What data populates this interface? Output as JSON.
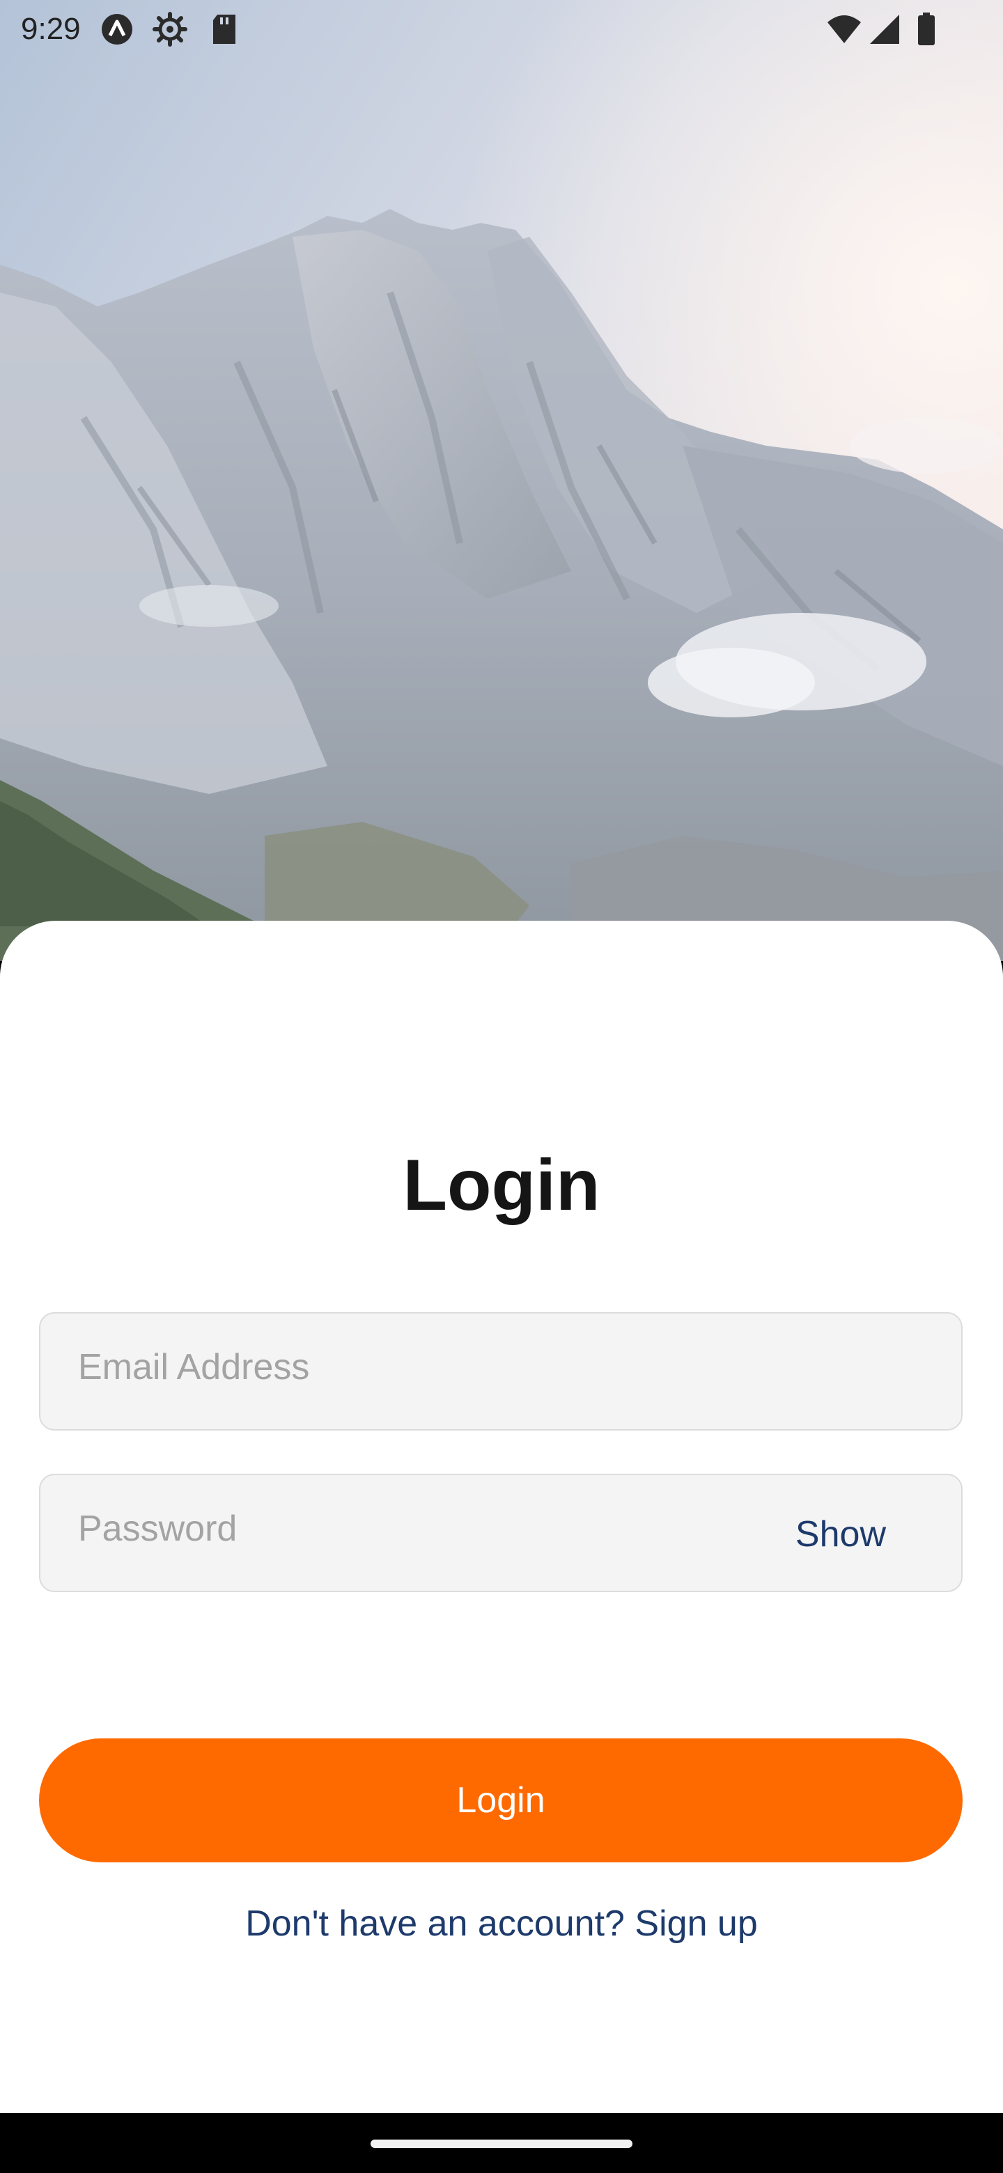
{
  "status_bar": {
    "time": "9:29",
    "left_icons": [
      "expo-icon",
      "settings-icon",
      "sd-card-icon"
    ],
    "right_icons": [
      "wifi-icon",
      "cell-signal-icon",
      "battery-icon"
    ]
  },
  "hero": {
    "image": "mountain-landscape"
  },
  "login": {
    "title": "Login",
    "email_placeholder": "Email Address",
    "email_value": "",
    "password_placeholder": "Password",
    "password_value": "",
    "show_label": "Show",
    "button_label": "Login",
    "signup_text": "Don't have an account? Sign up"
  },
  "colors": {
    "accent": "#ff6a00",
    "link": "#1d3a6b",
    "field_background": "#f4f4f4",
    "card_background": "#ffffff"
  }
}
